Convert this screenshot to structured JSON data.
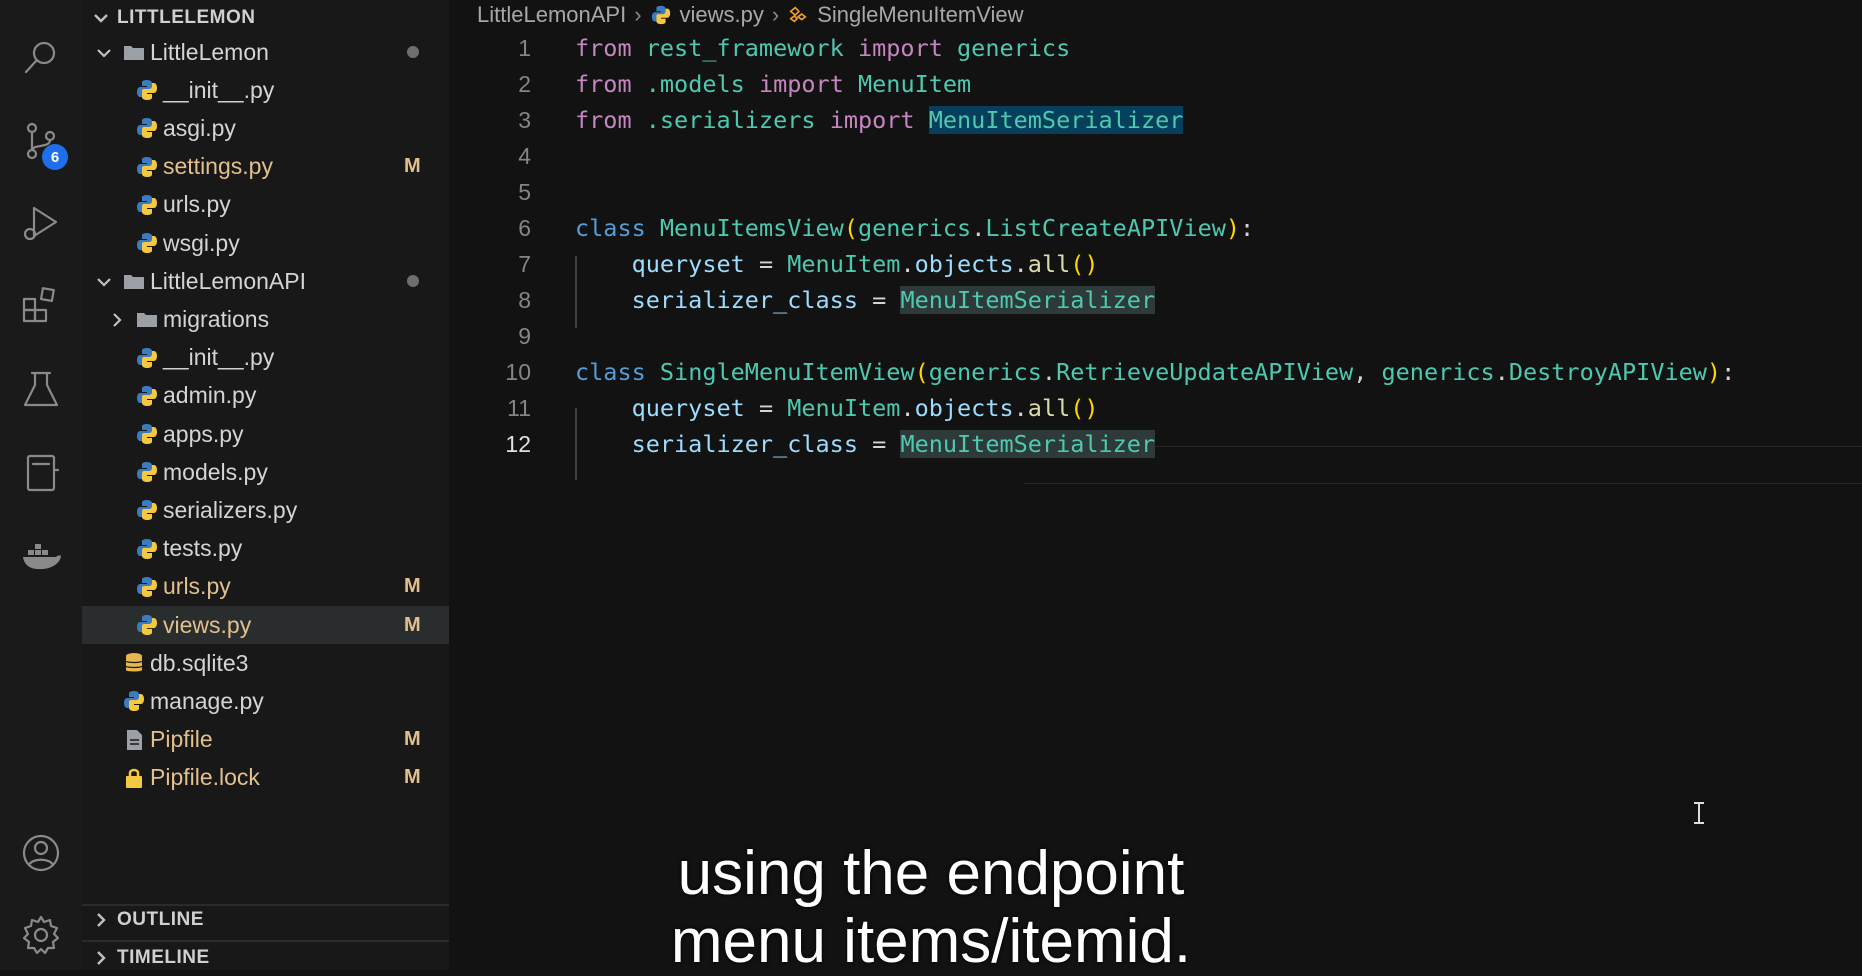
{
  "activity_bar": {
    "icons": [
      "search-icon",
      "source-control-icon",
      "run-debug-icon",
      "extensions-icon",
      "testing-icon",
      "notebook-icon",
      "docker-icon",
      "account-icon",
      "settings-gear-icon"
    ],
    "source_control_badge": "6"
  },
  "explorer": {
    "root_label": "LITTLELEMON",
    "items": [
      {
        "label": "LittleLemon",
        "type": "folder",
        "status": "dot"
      },
      {
        "label": "__init__.py",
        "type": "python",
        "status": ""
      },
      {
        "label": "asgi.py",
        "type": "python",
        "status": ""
      },
      {
        "label": "settings.py",
        "type": "python",
        "status": "M"
      },
      {
        "label": "urls.py",
        "type": "python",
        "status": ""
      },
      {
        "label": "wsgi.py",
        "type": "python",
        "status": ""
      },
      {
        "label": "LittleLemonAPI",
        "type": "folder",
        "status": "dot"
      },
      {
        "label": "migrations",
        "type": "folder-collapsed",
        "status": ""
      },
      {
        "label": "__init__.py",
        "type": "python",
        "status": ""
      },
      {
        "label": "admin.py",
        "type": "python",
        "status": ""
      },
      {
        "label": "apps.py",
        "type": "python",
        "status": ""
      },
      {
        "label": "models.py",
        "type": "python",
        "status": ""
      },
      {
        "label": "serializers.py",
        "type": "python",
        "status": ""
      },
      {
        "label": "tests.py",
        "type": "python",
        "status": ""
      },
      {
        "label": "urls.py",
        "type": "python",
        "status": "M"
      },
      {
        "label": "views.py",
        "type": "python",
        "status": "M"
      },
      {
        "label": "db.sqlite3",
        "type": "database",
        "status": ""
      },
      {
        "label": "manage.py",
        "type": "python",
        "status": ""
      },
      {
        "label": "Pipfile",
        "type": "file",
        "status": "M"
      },
      {
        "label": "Pipfile.lock",
        "type": "lock",
        "status": "M"
      }
    ],
    "outline_label": "OUTLINE",
    "timeline_label": "TIMELINE"
  },
  "breadcrumb": {
    "folder": "LittleLemonAPI",
    "file": "views.py",
    "symbol": "SingleMenuItemView"
  },
  "editor": {
    "line_numbers": [
      "1",
      "2",
      "3",
      "4",
      "5",
      "6",
      "7",
      "8",
      "9",
      "10",
      "11",
      "12"
    ],
    "active_line": "12",
    "tokens": {
      "from": "from",
      "import": "import",
      "class": "class",
      "rest_framework": "rest_framework",
      "generics": "generics",
      "dot_models": ".models",
      "MenuItem": "MenuItem",
      "dot_serializers": ".serializers",
      "MenuItemSerializer": "MenuItemSerializer",
      "MenuItemsView": "MenuItemsView",
      "ListCreateAPIView": "ListCreateAPIView",
      "queryset": "queryset",
      "serializer_class": "serializer_class",
      "objects": "objects",
      "all": "all",
      "SingleMenuItemView": "SingleMenuItemView",
      "RetrieveUpdateAPIView": "RetrieveUpdateAPIView",
      "DestroyAPIView": "DestroyAPIView"
    }
  },
  "subtitle": {
    "line1": "using the endpoint",
    "line2": "menu items/itemid."
  },
  "colors": {
    "accent_badge": "#1f6feb",
    "modified": "#e2c08d",
    "keyword": "#c586c0",
    "class_name": "#4ec9b0",
    "variable": "#9cdcfe"
  }
}
